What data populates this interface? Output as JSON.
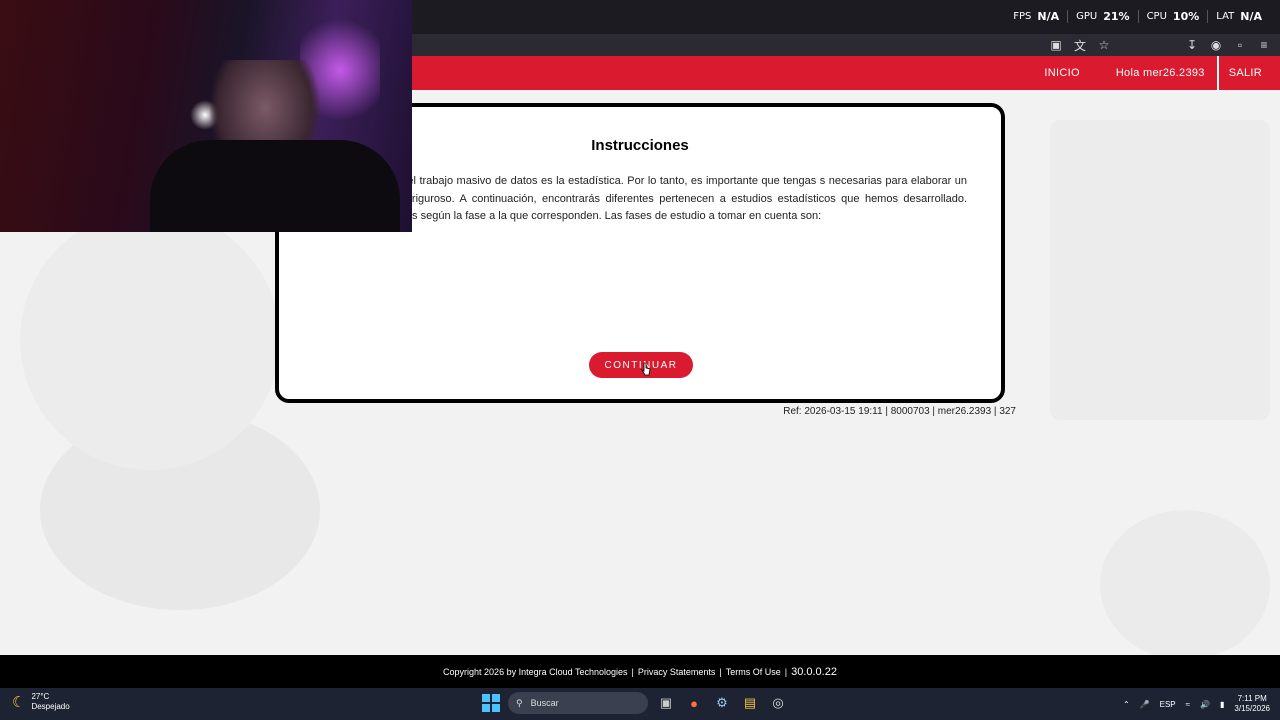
{
  "overlay": {
    "stats": [
      {
        "label": "FPS",
        "value": "N/A"
      },
      {
        "label": "GPU",
        "value": "21%"
      },
      {
        "label": "CPU",
        "value": "10%"
      },
      {
        "label": "LAT",
        "value": "N/A"
      }
    ]
  },
  "toolbar": {
    "left_icons": [
      "screenshot-icon",
      "translate-icon",
      "star-icon"
    ],
    "right_icons": [
      "download-icon",
      "profile-icon",
      "extensions-icon",
      "menu-icon"
    ]
  },
  "header": {
    "nav": {
      "inicio": "INICIO",
      "user": "Hola mer26.2393",
      "salir": "SALIR"
    },
    "accent": "#d91a2f"
  },
  "card": {
    "title": "Instrucciones",
    "text": "ones importantes del trabajo masivo de datos es la estadística. Por lo tanto, es importante que tengas s necesarias para elaborar un estudio estadístico riguroso. A continuación, encontrarás diferentes pertenecen a estudios estadísticos que hemos desarrollado. Deberás organizarlas según la fase a la que corresponden. Las fases de estudio a tomar en cuenta son:",
    "button": "CONTINUAR"
  },
  "ref": "Ref: 2026-03-15 19:11 | 8000703 | mer26.2393 | 327",
  "footer": {
    "copyright": "Copyright 2026 by Integra Cloud Technologies",
    "privacy": "Privacy Statements",
    "terms": "Terms Of Use",
    "version": "30.0.0.22"
  },
  "taskbar": {
    "weather_temp": "27°C",
    "weather_desc": "Despejado",
    "search_placeholder": "Buscar",
    "lang": "ESP",
    "time": "7:11 PM",
    "date": "3/15/2026"
  }
}
